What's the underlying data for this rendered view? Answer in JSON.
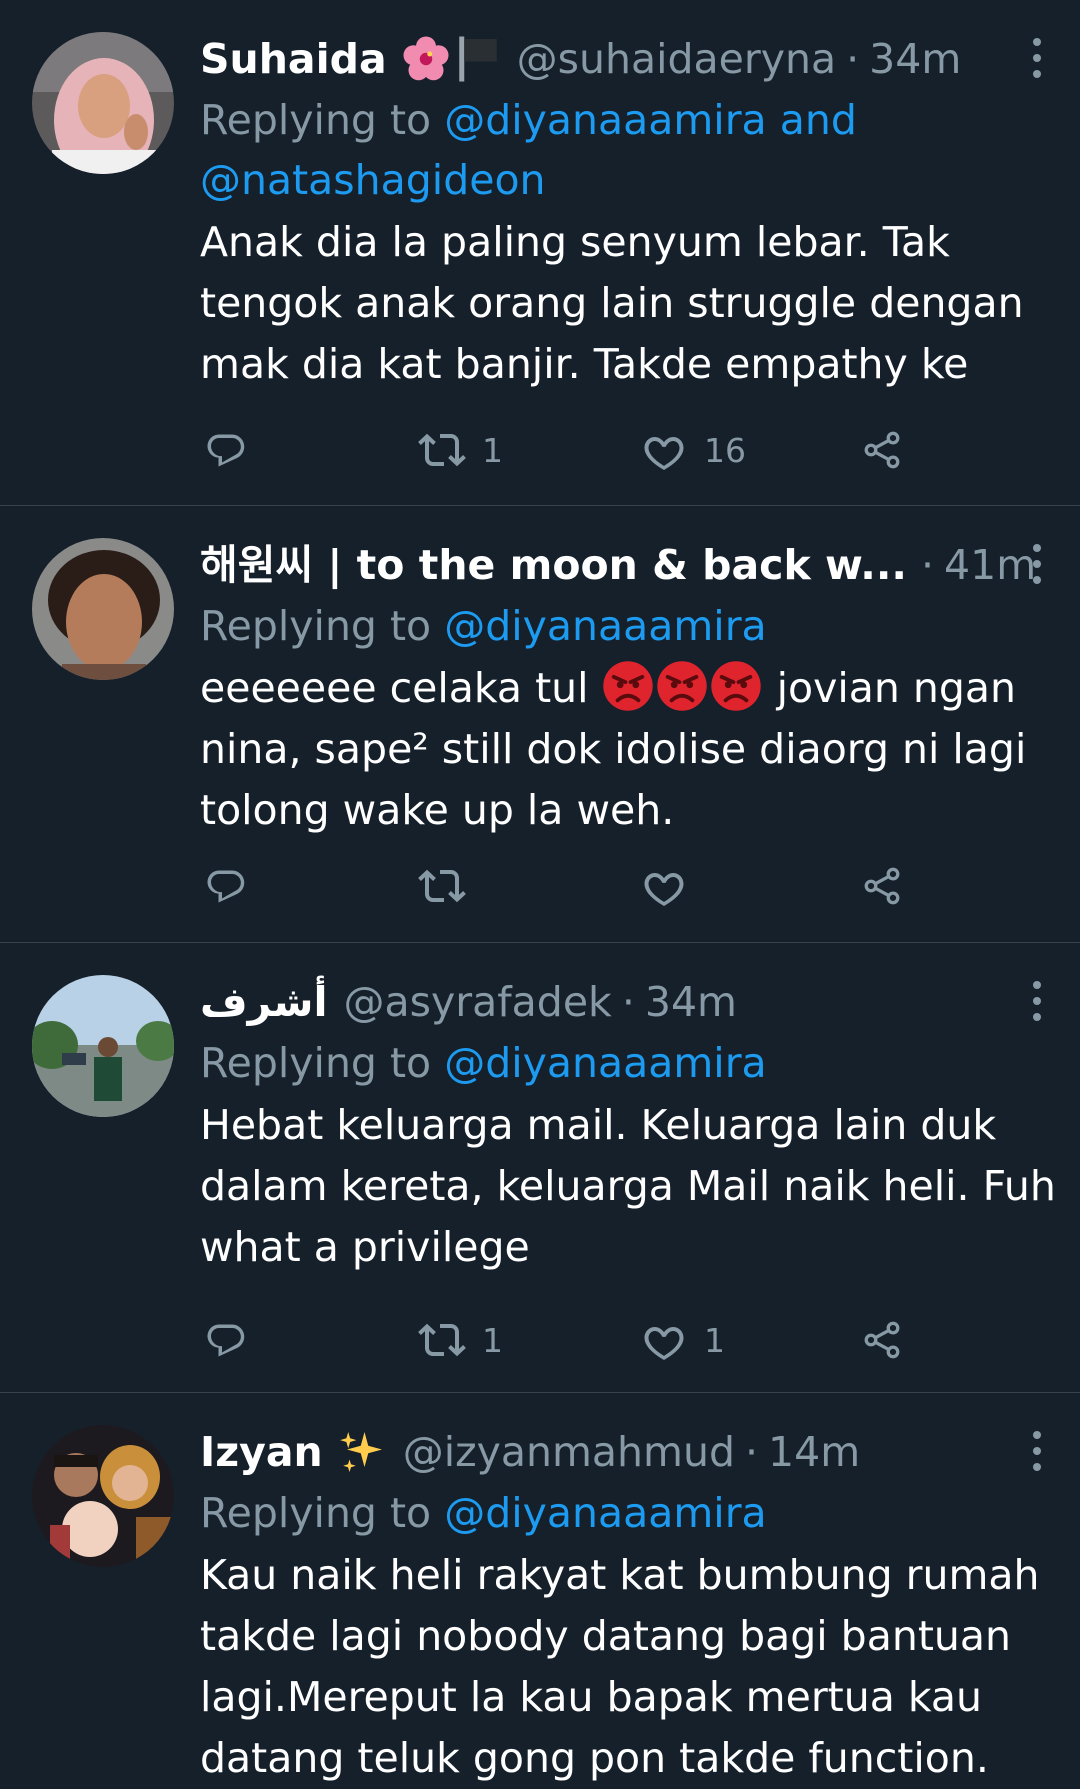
{
  "colors": {
    "background": "#15202b",
    "text": "#ffffff",
    "muted": "#8899a6",
    "link": "#1d9bf0",
    "divider": "#38444d"
  },
  "tweets": [
    {
      "name": "Suhaida",
      "name_emoji": [
        "hibiscus-emoji",
        "black-flag-emoji"
      ],
      "handle": "@suhaidaeryna",
      "separator": "·",
      "time": "34m",
      "replying_label": "Replying to",
      "replying_mentions": "@diyanaaamira and @natashagideon",
      "text": "Anak dia la paling senyum lebar. Tak tengok anak orang lain struggle dengan mak dia kat banjir. Takde empathy ke",
      "reply_count": "",
      "retweet_count": "1",
      "like_count": "16"
    },
    {
      "name": "해원씨 | to the moon & back w...",
      "handle": "",
      "separator": "·",
      "time": "41m",
      "replying_label": "Replying to",
      "replying_mentions": "@diyanaaamira",
      "text_before_emoji": "eeeeeee celaka tul ",
      "text_emoji": [
        "angry-face-emoji",
        "angry-face-emoji",
        "angry-face-emoji"
      ],
      "text_after_emoji": " jovian ngan nina, sape² still dok idolise diaorg ni lagi tolong wake up la weh.",
      "reply_count": "",
      "retweet_count": "",
      "like_count": ""
    },
    {
      "name": "أشرف",
      "handle": "@asyrafadek",
      "separator": "·",
      "time": "34m",
      "replying_label": "Replying to",
      "replying_mentions": "@diyanaaamira",
      "text": "Hebat keluarga mail. Keluarga lain duk dalam kereta, keluarga Mail naik heli. Fuh what a privilege",
      "reply_count": "",
      "retweet_count": "1",
      "like_count": "1"
    },
    {
      "name": "Izyan",
      "name_emoji": [
        "sparkles-emoji"
      ],
      "handle": "@izyanmahmud",
      "separator": "·",
      "time": "14m",
      "replying_label": "Replying to",
      "replying_mentions": "@diyanaaamira",
      "text": "Kau naik heli rakyat kat bumbung rumah takde lagi nobody datang bagi bantuan lagi.Mereput la kau bapak mertua kau datang teluk gong pon takde function.",
      "reply_count": "",
      "retweet_count": "",
      "like_count": ""
    }
  ]
}
